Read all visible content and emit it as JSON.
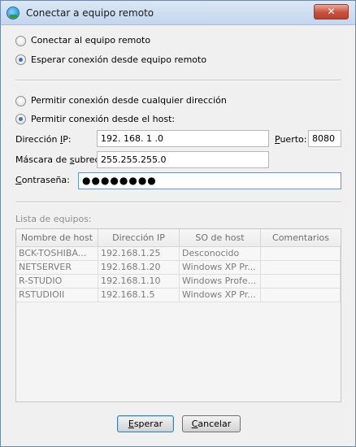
{
  "window": {
    "title": "Conectar a equipo remoto",
    "close_glyph": "✕",
    "icon": "network-globe-icon"
  },
  "mode": {
    "connect_label": "Conectar al equipo remoto",
    "wait_label": "Esperar conexión desde equipo remoto",
    "selected": "wait"
  },
  "permission": {
    "any_label": "Permitir conexión desde cualquier dirección",
    "host_label": "Permitir conexión desde el host:",
    "selected": "host"
  },
  "fields": {
    "ip_label_pre": "Dirección ",
    "ip_label_u": "I",
    "ip_label_post": "P:",
    "ip_value": "192. 168. 1  .0",
    "port_label_u": "P",
    "port_label_post": "uerto:",
    "port_value": "8080",
    "mask_label_pre": "Máscara de ",
    "mask_label_u": "s",
    "mask_label_post": "ubred:",
    "mask_value": "255.255.255.0",
    "password_label_u": "C",
    "password_label_post": "ontraseña:",
    "password_value": "●●●●●●●●"
  },
  "hosts": {
    "label": "Lista de equipos:",
    "columns": [
      "Nombre de host",
      "Dirección IP",
      "SO de host",
      "Comentarios"
    ],
    "rows": [
      [
        "BCK-TOSHIBA...",
        "192.168.1.25",
        "Desconocido",
        ""
      ],
      [
        "NETSERVER",
        "192.168.1.20",
        "Windows XP Pr...",
        ""
      ],
      [
        "R-STUDIO",
        "192.168.1.10",
        "Windows Profe...",
        ""
      ],
      [
        "RSTUDIOII",
        "192.168.1.5",
        "Windows XP Pr...",
        ""
      ]
    ]
  },
  "buttons": {
    "wait_u": "E",
    "wait_post": "sperar",
    "cancel_u": "C",
    "cancel_post": "ancelar"
  },
  "colors": {
    "radio_selected": "#3b70c8",
    "close_button": "#c9503c"
  }
}
